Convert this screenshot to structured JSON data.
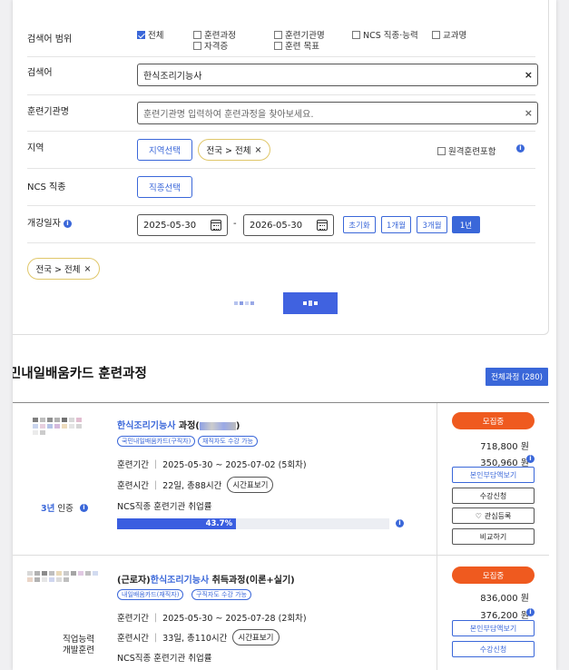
{
  "search": {
    "scope_label": "검색어 범위",
    "scope_options": [
      {
        "label": "전체",
        "checked": true
      },
      {
        "label": "훈련과정",
        "checked": false
      },
      {
        "label": "훈련기관명",
        "checked": false
      },
      {
        "label": "NCS 직종·능력",
        "checked": false
      },
      {
        "label": "교과명",
        "checked": false
      },
      {
        "label": "자격증",
        "checked": false
      },
      {
        "label": "훈련 목표",
        "checked": false
      }
    ],
    "keyword_label": "검색어",
    "keyword_value": "한식조리기능사",
    "org_label": "훈련기관명",
    "org_placeholder": "훈련기관명 입력하여 훈련과정을 찾아보세요.",
    "region_label": "지역",
    "region_button": "지역선택",
    "region_chip": "전국 > 전체",
    "remote_label": "원격훈련포함",
    "ncs_label": "NCS 직종",
    "ncs_button": "직종선택",
    "date_label": "개강일자",
    "date_from": "2025-05-30",
    "date_to": "2026-05-30",
    "date_sep": "-",
    "period_buttons": [
      "초기화",
      "1개월",
      "3개월",
      "1년"
    ],
    "selected_chip": "전국 > 전체",
    "clear_symbol": "×"
  },
  "results": {
    "title": "민내일배움카드 훈련과정",
    "total_button": "전체과정 (280)"
  },
  "courses": [
    {
      "title_link": "한식조리기능사",
      "title_rest": " 과정(",
      "tags": [
        "국민내일배움카드(구직자)",
        "재직자도 수강 가능"
      ],
      "period_label": "훈련기간",
      "period": "2025-05-30 ~ 2025-07-02 (5회차)",
      "time_label": "훈련시간",
      "time": "22일, 총88시간",
      "timetable_btn": "시간표보기",
      "cert_text": "인증",
      "ncs_rate_label": "NCS직종 훈련기관 취업률",
      "ncs_rate": 43.7,
      "ncs_rate_text": "43.7%",
      "status": "모집중",
      "price_total": "718,800 원",
      "price_self": "350,960 원",
      "buttons": [
        "본인부담액보기",
        "수강신청",
        "관심등록",
        "비교하기"
      ]
    },
    {
      "title_prefix": "(근로자)",
      "title_link": "한식조리기능사",
      "title_rest": " 취득과정(이론+실기)",
      "tags": [
        "내일배움카드(재직자)",
        "구직자도 수강 가능"
      ],
      "period_label": "훈련기간",
      "period": "2025-05-30 ~ 2025-07-28 (2회차)",
      "time_label": "훈련시간",
      "time": "33일, 총110시간",
      "timetable_btn": "시간표보기",
      "org_text_1": "직업능력",
      "org_text_2": "개발훈련",
      "ncs_rate_label": "NCS직종 훈련기관 취업률",
      "status": "모집중",
      "price_total": "836,000 원",
      "price_self": "376,200 원",
      "buttons": [
        "본인부담액보기",
        "수강신청"
      ]
    }
  ],
  "colors": {
    "accent": "#3a67d9",
    "status": "#ef5a1f",
    "chip_border": "#e0c76a"
  }
}
